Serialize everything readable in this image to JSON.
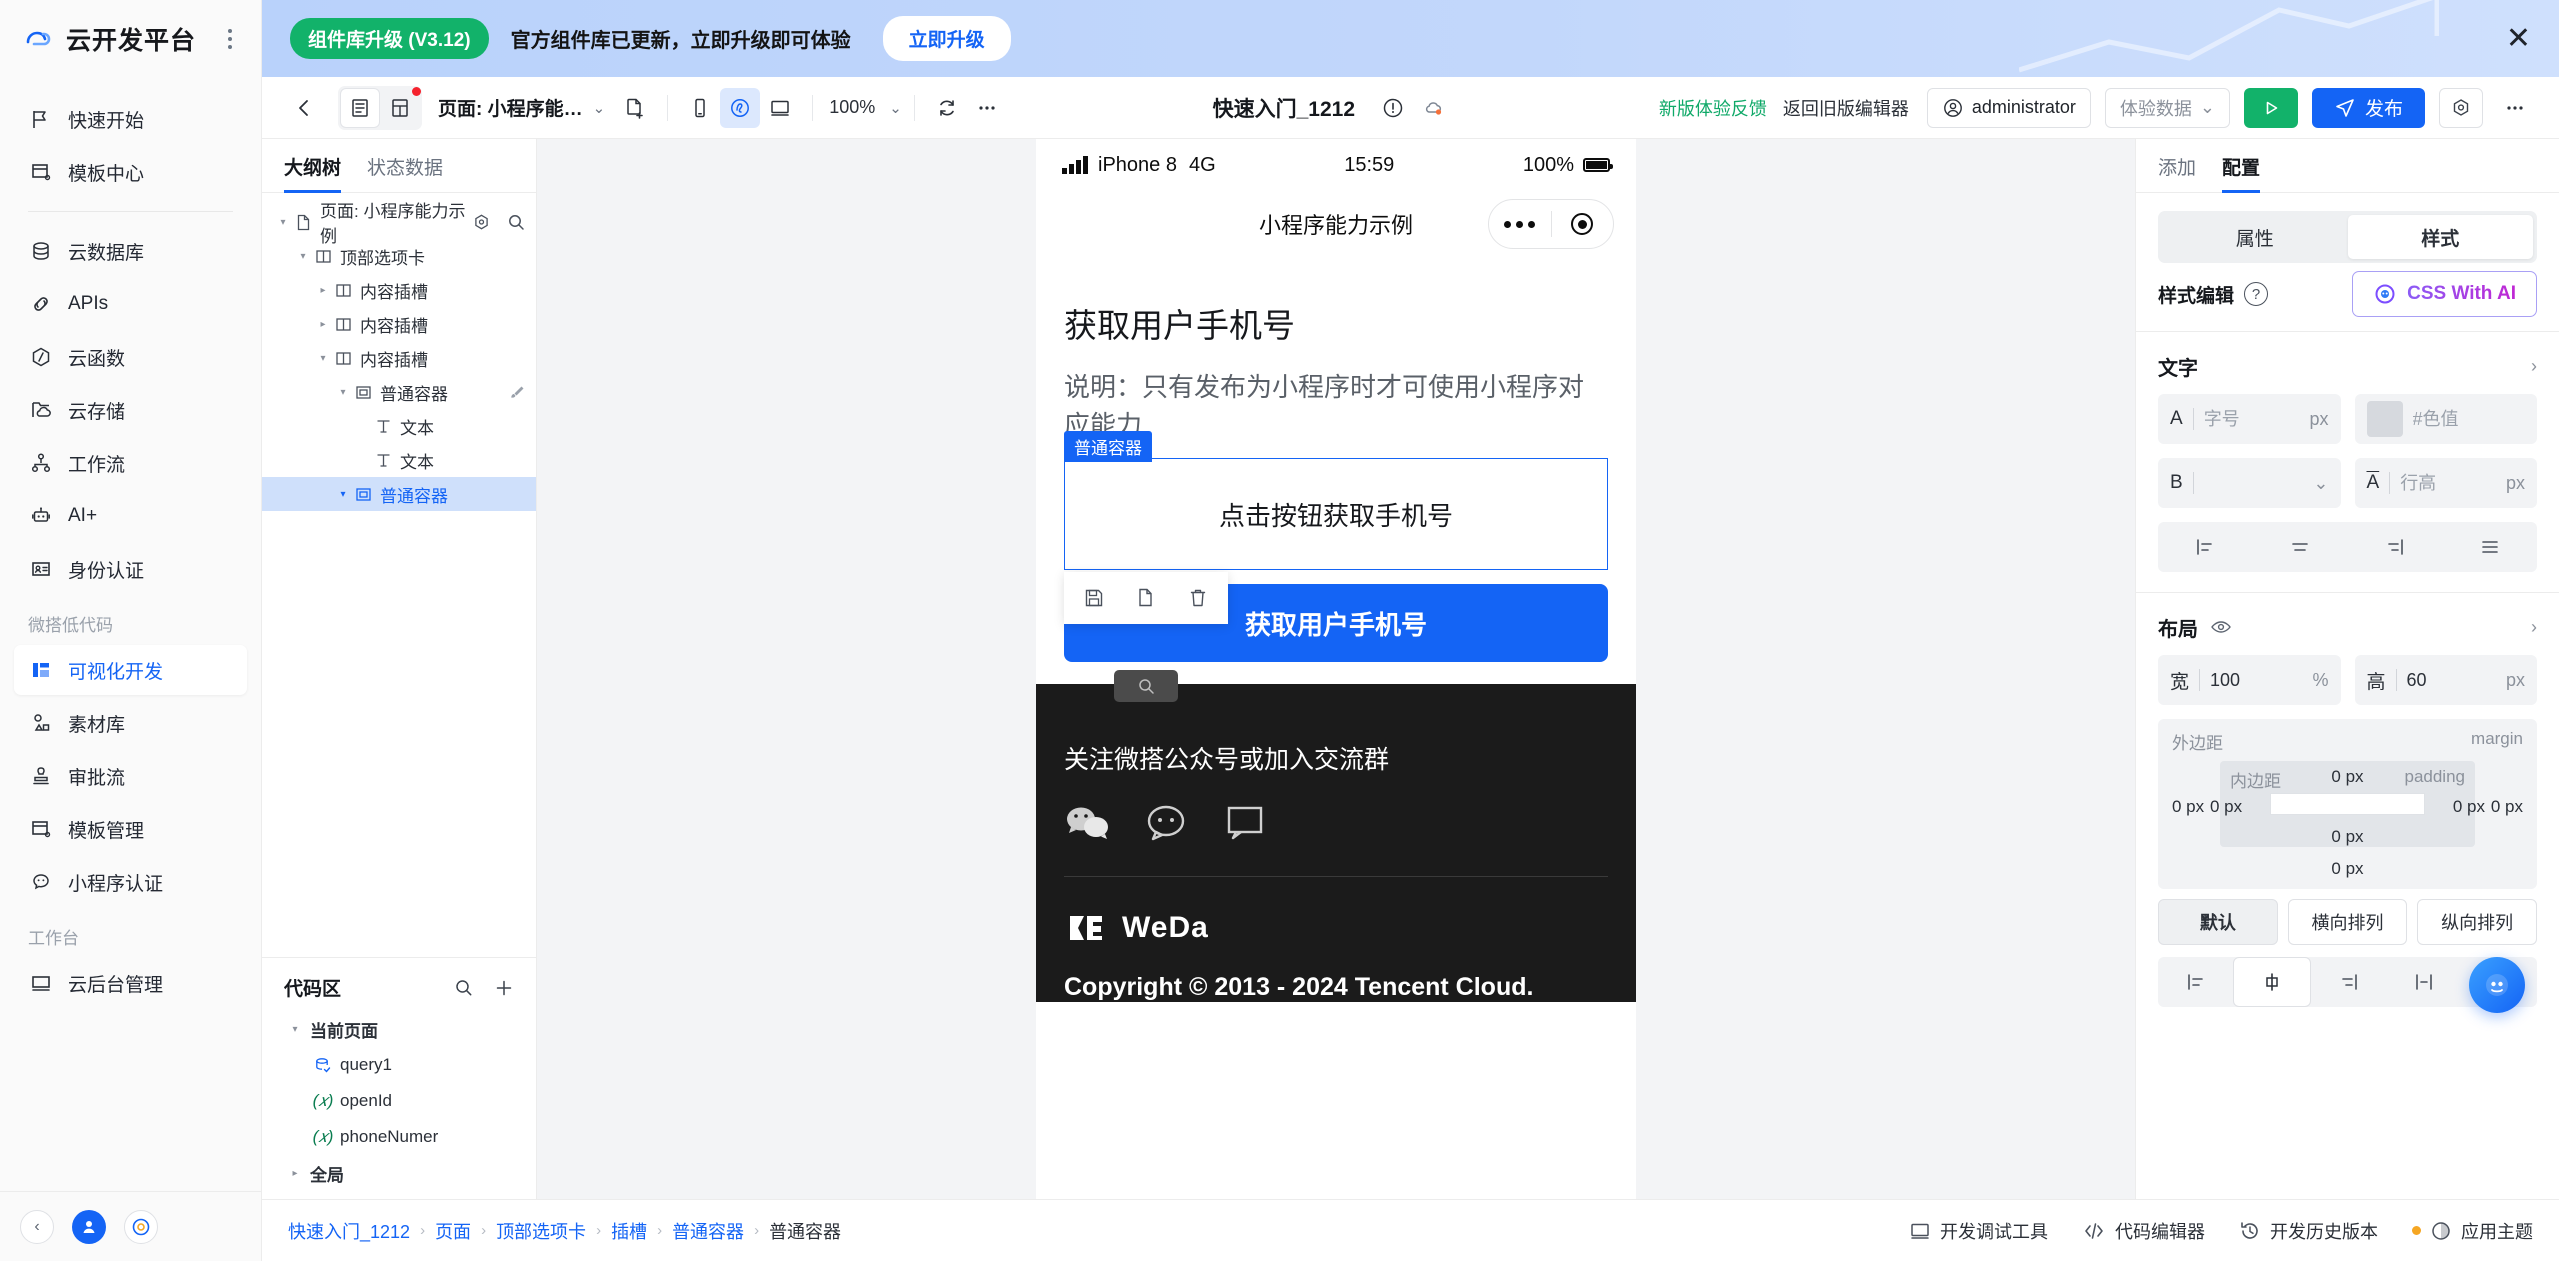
{
  "brand": {
    "name": "云开发平台",
    "logo_icon": "cloud-logo-icon",
    "menu_icon": "kebab-menu-icon"
  },
  "banner": {
    "pill": "组件库升级 (V3.12)",
    "message": "官方组件库已更新，立即升级即可体验",
    "action": "立即升级",
    "close_icon": "close-icon"
  },
  "sidebar": {
    "items": [
      {
        "label": "快速开始",
        "icon": "flag-icon",
        "active": false
      },
      {
        "label": "模板中心",
        "icon": "template-icon",
        "active": false
      },
      {
        "label": "云数据库",
        "icon": "database-icon",
        "active": false
      },
      {
        "label": "APIs",
        "icon": "api-link-icon",
        "active": false
      },
      {
        "label": "云函数",
        "icon": "function-icon",
        "active": false
      },
      {
        "label": "云存储",
        "icon": "cloud-storage-icon",
        "active": false
      },
      {
        "label": "工作流",
        "icon": "workflow-icon",
        "active": false
      },
      {
        "label": "AI+",
        "icon": "robot-icon",
        "active": false
      },
      {
        "label": "身份认证",
        "icon": "id-card-icon",
        "active": false
      },
      {
        "label": "可视化开发",
        "icon": "layout-icon",
        "active": true
      },
      {
        "label": "素材库",
        "icon": "material-icon",
        "active": false
      },
      {
        "label": "审批流",
        "icon": "approval-icon",
        "active": false
      },
      {
        "label": "模板管理",
        "icon": "template-manage-icon",
        "active": false
      },
      {
        "label": "小程序认证",
        "icon": "wechat-icon",
        "active": false
      },
      {
        "label": "云后台管理",
        "icon": "monitor-icon",
        "active": false
      }
    ],
    "group_lowcode": "微搭低代码",
    "group_workbench": "工作台",
    "footer": {
      "collapse_icon": "chevron-left-icon",
      "user_icon": "user-icon",
      "help_icon": "support-icon"
    }
  },
  "toolbar": {
    "back_icon": "arrow-left-icon",
    "view_outline_icon": "outline-view-icon",
    "view_grid_icon": "grid-view-icon",
    "page_label": "页面: 小程序能…",
    "page_caret": "⌄",
    "add_page_icon": "add-page-icon",
    "device_mobile_icon": "mobile-device-icon",
    "device_wechat_icon": "miniprogram-device-icon",
    "device_desktop_icon": "desktop-device-icon",
    "zoom": "100%",
    "zoom_caret": "⌄",
    "refresh_icon": "refresh-icon",
    "more_icon": "more-horizontal-icon",
    "app_title": "快速入门_1212",
    "warning_icon": "alert-circle-icon",
    "cloud_icon": "cloud-status-icon",
    "feedback_link": "新版体验反馈",
    "old_editor_link": "返回旧版编辑器",
    "user": "administrator",
    "user_icon": "user-circle-icon",
    "env_label": "体验数据",
    "env_caret": "⌄",
    "preview_icon": "play-icon",
    "publish": "发布",
    "publish_icon": "send-icon",
    "settings_icon": "settings-hex-icon",
    "more_right_icon": "more-horizontal-icon"
  },
  "left_panel": {
    "tabs": [
      {
        "label": "大纲树",
        "active": true
      },
      {
        "label": "状态数据",
        "active": false
      }
    ],
    "tree_header": {
      "label": "页面: 小程序能力示例",
      "icon": "page-file-icon",
      "settings_icon": "settings-hex-icon",
      "search_icon": "search-icon"
    },
    "tree": [
      {
        "label": "顶部选项卡",
        "icon": "tab-container-icon",
        "depth": 1,
        "arrow": "▾",
        "selected": false
      },
      {
        "label": "内容插槽",
        "icon": "slot-icon",
        "depth": 2,
        "arrow": "▸",
        "selected": false
      },
      {
        "label": "内容插槽",
        "icon": "slot-icon",
        "depth": 2,
        "arrow": "▸",
        "selected": false
      },
      {
        "label": "内容插槽",
        "icon": "slot-icon",
        "depth": 2,
        "arrow": "▾",
        "selected": false
      },
      {
        "label": "普通容器",
        "icon": "container-icon",
        "depth": 3,
        "arrow": "▾",
        "selected": false,
        "brush": "brush-icon"
      },
      {
        "label": "文本",
        "icon": "text-icon",
        "depth": 4,
        "arrow": "",
        "selected": false
      },
      {
        "label": "文本",
        "icon": "text-icon",
        "depth": 4,
        "arrow": "",
        "selected": false
      },
      {
        "label": "普通容器",
        "icon": "container-icon",
        "depth": 3,
        "arrow": "▾",
        "selected": true
      }
    ],
    "code_section": {
      "title": "代码区",
      "search_icon": "search-icon",
      "add_icon": "plus-icon",
      "rows": [
        {
          "label": "当前页面",
          "icon": "",
          "arrow": "▾",
          "bold": true,
          "depth": 1
        },
        {
          "label": "query1",
          "icon": "query-icon",
          "arrow": "",
          "bold": false,
          "depth": 2
        },
        {
          "label": "openId",
          "icon": "var-icon",
          "arrow": "",
          "bold": false,
          "depth": 2
        },
        {
          "label": "phoneNumer",
          "icon": "var-icon",
          "arrow": "",
          "bold": false,
          "depth": 2
        },
        {
          "label": "全局",
          "icon": "",
          "arrow": "▸",
          "bold": true,
          "depth": 1
        }
      ]
    }
  },
  "canvas": {
    "status_bar": {
      "device": "iPhone 8",
      "network": "4G",
      "time": "15:59",
      "battery": "100%"
    },
    "nav_title": "小程序能力示例",
    "capsule": {
      "more_icon": "more-dots-icon",
      "target_icon": "target-circle-icon"
    },
    "heading": "获取用户手机号",
    "description": "说明：只有发布为小程序时才可使用小程序对应能力",
    "selected_tag": "普通容器",
    "container_text": "点击按钮获取手机号",
    "context_actions": [
      {
        "icon": "save-icon",
        "name": "save-action"
      },
      {
        "icon": "copy-icon",
        "name": "copy-action"
      },
      {
        "icon": "trash-icon",
        "name": "delete-action"
      }
    ],
    "primary_button": "获取用户手机号",
    "footer": {
      "follow_text": "关注微搭公众号或加入交流群",
      "socials": [
        "wechat-icon",
        "chat-bubble-icon",
        "message-icon"
      ],
      "brand": "WeDa",
      "copyright": "Copyright © 2013 - 2024 Tencent Cloud."
    }
  },
  "right_panel": {
    "tabs": [
      {
        "label": "添加",
        "active": false
      },
      {
        "label": "配置",
        "active": true
      }
    ],
    "segments": [
      {
        "label": "属性",
        "active": false
      },
      {
        "label": "样式",
        "active": true
      }
    ],
    "style_edit": {
      "label": "样式编辑",
      "help_icon": "question-icon",
      "ai_button": "CSS With AI",
      "ai_icon": "ai-sparkle-icon"
    },
    "text_section": {
      "title": "文字",
      "chevron": "›",
      "font_size_lead": "A",
      "font_size_placeholder": "字号",
      "font_size_unit": "px",
      "color_placeholder": "#色值",
      "bold_lead": "B",
      "bold_value": "",
      "line_height_lead": "A",
      "line_height_placeholder": "行高",
      "line_height_unit": "px",
      "align_icons": [
        "align-left-icon",
        "align-center-icon",
        "align-right-icon",
        "align-justify-icon"
      ]
    },
    "layout_section": {
      "title": "布局",
      "eye_icon": "eye-icon",
      "chevron": "›",
      "width_label": "宽",
      "width_value": "100",
      "width_unit": "%",
      "height_label": "高",
      "height_value": "60",
      "height_unit": "px",
      "margin_label": "外边距",
      "margin_tag": "margin",
      "padding_label": "内边距",
      "padding_tag": "padding",
      "margin_top": "0 px",
      "margin_right": "0 px",
      "margin_bottom": "0 px",
      "margin_left": "0 px",
      "padding_top": "0 px",
      "padding_right": "0 px",
      "padding_bottom": "0 px",
      "padding_left": "0 px",
      "direction": [
        {
          "label": "默认",
          "active": true
        },
        {
          "label": "横向排列",
          "active": false
        },
        {
          "label": "纵向排列",
          "active": false
        }
      ],
      "align_icons": [
        "align-start-icon",
        "align-middle-icon",
        "align-end-icon",
        "stretch-icon",
        "space-between-icon"
      ]
    },
    "fab_icon": "assistant-bot-icon"
  },
  "footer": {
    "breadcrumb": [
      "快速入门_1212",
      "页面",
      "顶部选项卡",
      "插槽",
      "普通容器",
      "普通容器"
    ],
    "separator": "›",
    "tools": [
      {
        "label": "开发调试工具",
        "icon": "debug-icon"
      },
      {
        "label": "代码编辑器",
        "icon": "code-icon"
      },
      {
        "label": "开发历史版本",
        "icon": "history-icon"
      },
      {
        "label": "应用主题",
        "icon": "theme-icon"
      }
    ]
  }
}
